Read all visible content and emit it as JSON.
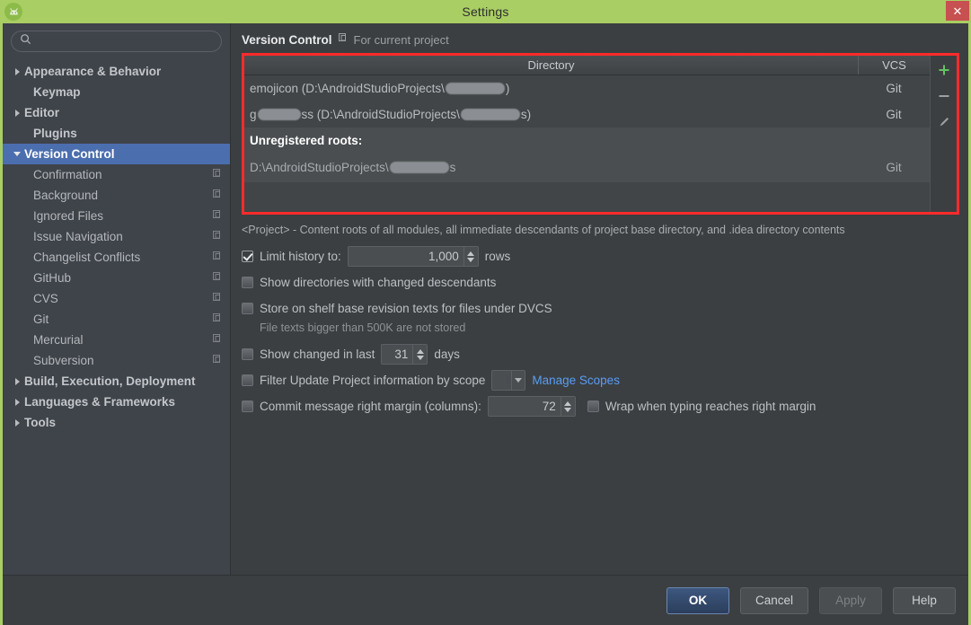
{
  "window": {
    "title": "Settings",
    "close_label": "✕",
    "app_icon": "android-studio-icon",
    "accent_green": "#a9ce63",
    "highlight_red": "#ff2b2b"
  },
  "search": {
    "value": "",
    "placeholder": "",
    "icon": "search-icon"
  },
  "sidebar": {
    "items": [
      {
        "label": "Appearance & Behavior",
        "level": 0,
        "arrow": "right",
        "selected": false,
        "project_icon": false
      },
      {
        "label": "Keymap",
        "level": 0,
        "arrow": "none",
        "selected": false,
        "project_icon": false
      },
      {
        "label": "Editor",
        "level": 0,
        "arrow": "right",
        "selected": false,
        "project_icon": false
      },
      {
        "label": "Plugins",
        "level": 0,
        "arrow": "none",
        "selected": false,
        "project_icon": false
      },
      {
        "label": "Version Control",
        "level": 0,
        "arrow": "down",
        "selected": true,
        "project_icon": false
      },
      {
        "label": "Confirmation",
        "level": 1,
        "arrow": "none",
        "selected": false,
        "project_icon": true
      },
      {
        "label": "Background",
        "level": 1,
        "arrow": "none",
        "selected": false,
        "project_icon": true
      },
      {
        "label": "Ignored Files",
        "level": 1,
        "arrow": "none",
        "selected": false,
        "project_icon": true
      },
      {
        "label": "Issue Navigation",
        "level": 1,
        "arrow": "none",
        "selected": false,
        "project_icon": true
      },
      {
        "label": "Changelist Conflicts",
        "level": 1,
        "arrow": "none",
        "selected": false,
        "project_icon": true
      },
      {
        "label": "GitHub",
        "level": 1,
        "arrow": "none",
        "selected": false,
        "project_icon": true
      },
      {
        "label": "CVS",
        "level": 1,
        "arrow": "none",
        "selected": false,
        "project_icon": true
      },
      {
        "label": "Git",
        "level": 1,
        "arrow": "none",
        "selected": false,
        "project_icon": true
      },
      {
        "label": "Mercurial",
        "level": 1,
        "arrow": "none",
        "selected": false,
        "project_icon": true
      },
      {
        "label": "Subversion",
        "level": 1,
        "arrow": "none",
        "selected": false,
        "project_icon": true
      },
      {
        "label": "Build, Execution, Deployment",
        "level": 0,
        "arrow": "right",
        "selected": false,
        "project_icon": false
      },
      {
        "label": "Languages & Frameworks",
        "level": 0,
        "arrow": "right",
        "selected": false,
        "project_icon": false
      },
      {
        "label": "Tools",
        "level": 0,
        "arrow": "right",
        "selected": false,
        "project_icon": false
      }
    ]
  },
  "main": {
    "title": "Version Control",
    "scope_label": "For current project",
    "scope_icon": "project-scope-icon",
    "table": {
      "columns": {
        "directory": "Directory",
        "vcs": "VCS"
      },
      "rows": [
        {
          "kind": "entry",
          "prefix": "emojicon (D:\\AndroidStudioProjects\\",
          "redacted_width": 66,
          "suffix": ")",
          "vcs": "Git"
        },
        {
          "kind": "entry",
          "pre_redacted_width": 48,
          "prefix_lead": "g",
          "prefix": "ss (D:\\AndroidStudioProjects\\",
          "redacted_width": 66,
          "suffix": "s)",
          "vcs": "Git"
        },
        {
          "kind": "section",
          "label": "Unregistered roots:",
          "vcs": ""
        },
        {
          "kind": "unregistered",
          "prefix": "D:\\AndroidStudioProjects\\",
          "redacted_width": 66,
          "suffix": "s",
          "vcs": "Git"
        }
      ]
    },
    "toolbar": {
      "add_label": "+",
      "remove_label": "–",
      "edit_label": "edit-pencil-icon"
    },
    "description": "<Project> - Content roots of all modules, all immediate descendants of project base directory, and .idea directory contents",
    "options": {
      "limit_history": {
        "label": "Limit history to:",
        "checked": true,
        "value": "1,000",
        "unit": "rows"
      },
      "show_directories": {
        "label": "Show directories with changed descendants",
        "checked": false
      },
      "store_on_shelf": {
        "label": "Store on shelf base revision texts for files under DVCS",
        "checked": false,
        "note": "File texts bigger than 500K are not stored"
      },
      "show_changed_in_last": {
        "label": "Show changed in last",
        "checked": false,
        "value": "31",
        "unit": "days"
      },
      "filter_by_scope": {
        "label": "Filter Update Project information by scope",
        "checked": false,
        "scope_value": "",
        "manage_link": "Manage Scopes"
      },
      "commit_margin": {
        "label": "Commit message right margin (columns):",
        "checked": false,
        "value": "72"
      },
      "wrap_typing": {
        "label": "Wrap when typing reaches right margin",
        "checked": false
      }
    }
  },
  "footer": {
    "ok": "OK",
    "cancel": "Cancel",
    "apply": "Apply",
    "help": "Help"
  }
}
